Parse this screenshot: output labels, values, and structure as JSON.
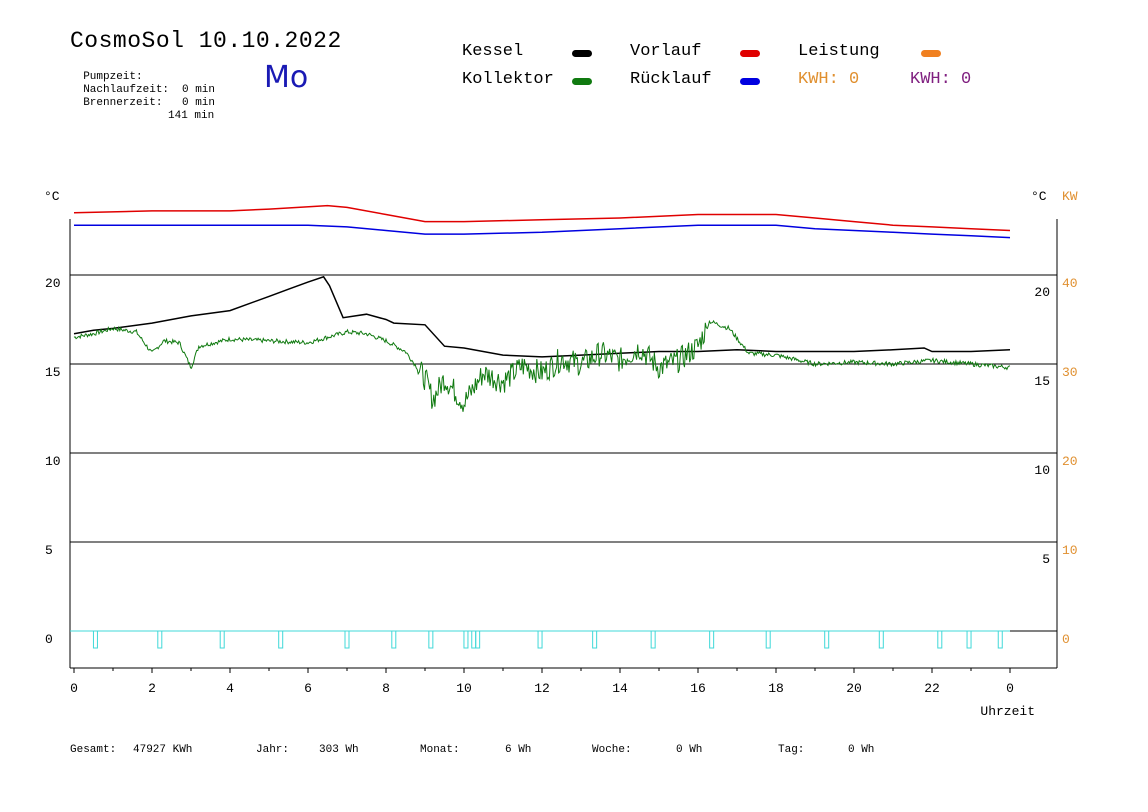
{
  "header": {
    "title": "CosmoSol 10.10.2022",
    "day": "Mo",
    "stats": [
      {
        "label": "Pumpzeit:",
        "value": "0 min"
      },
      {
        "label": "Nachlaufzeit:",
        "value": "0 min"
      },
      {
        "label": "Brennerzeit:",
        "value": "141 min"
      }
    ]
  },
  "legend": {
    "items": [
      {
        "label": "Kessel",
        "color": "#000000"
      },
      {
        "label": "Vorlauf",
        "color": "#e00000"
      },
      {
        "label": "Leistung",
        "color": "#f08020"
      },
      {
        "label": "Kollektor",
        "color": "#107a10"
      },
      {
        "label": "Rücklauf",
        "color": "#0000e0"
      }
    ],
    "kwh_orange": "KWH: 0",
    "kwh_purple": "KWH: 0",
    "kwh_orange_color": "#e09030",
    "kwh_purple_color": "#802080"
  },
  "footer": {
    "gesamt_label": "Gesamt:",
    "gesamt_value": "47927 KWh",
    "jahr_label": "Jahr:",
    "jahr_value": "303 Wh",
    "monat_label": "Monat:",
    "monat_value": "6 Wh",
    "woche_label": "Woche:",
    "woche_value": "0 Wh",
    "tag_label": "Tag:",
    "tag_value": "0 Wh"
  },
  "chart_data": {
    "type": "line",
    "xlabel": "Uhrzeit",
    "left_unit": "°C",
    "right_unit": "°C",
    "right_unit2": "KW",
    "left_ticks": [
      "20",
      "15",
      "10",
      "5",
      "0"
    ],
    "right_ticks": [
      "20",
      "15",
      "10",
      "5"
    ],
    "kw_ticks": [
      "40",
      "30",
      "20",
      "10",
      "0"
    ],
    "x_ticks": [
      "0",
      "2",
      "4",
      "6",
      "8",
      "10",
      "12",
      "14",
      "16",
      "18",
      "20",
      "22",
      "0"
    ],
    "xlim": [
      0,
      24
    ],
    "ylim": [
      0,
      20
    ],
    "grid": "horizontal",
    "colors": {
      "kessel": "#000000",
      "kollektor": "#107a10",
      "vorlauf": "#e00000",
      "ruecklauf": "#0000e0",
      "pump": "#40d8d8",
      "kw_axis": "#e09030"
    },
    "series": [
      {
        "name": "Kessel",
        "x": [
          0,
          0.5,
          1,
          2,
          3,
          4,
          5,
          5.5,
          6,
          6.4,
          6.55,
          6.9,
          7.5,
          8,
          8.2,
          9,
          9.5,
          10,
          11,
          12,
          13,
          14,
          15,
          16,
          17,
          18,
          19,
          20,
          21,
          21.8,
          22,
          23,
          24
        ],
        "y": [
          16.7,
          16.9,
          17.0,
          17.3,
          17.7,
          18.0,
          18.8,
          19.2,
          19.6,
          19.9,
          19.4,
          17.6,
          17.8,
          17.5,
          17.3,
          17.2,
          16.0,
          15.9,
          15.5,
          15.4,
          15.5,
          15.6,
          15.7,
          15.7,
          15.8,
          15.7,
          15.7,
          15.7,
          15.8,
          15.9,
          15.7,
          15.7,
          15.8
        ]
      },
      {
        "name": "Kollektor",
        "x": [
          0,
          0.5,
          1,
          1.6,
          2,
          2.3,
          2.7,
          3,
          3.2,
          4,
          5,
          6,
          7,
          7.5,
          8,
          8.5,
          9,
          9.2,
          9.5,
          10,
          10.5,
          11,
          11.5,
          12,
          12.5,
          13,
          13.5,
          14,
          14.5,
          15,
          15.5,
          16,
          16.3,
          16.8,
          17.3,
          18,
          19,
          20,
          21,
          22,
          23,
          24
        ],
        "y": [
          16.5,
          16.7,
          17.0,
          16.8,
          15.6,
          16.3,
          16.2,
          14.8,
          16.0,
          16.4,
          16.3,
          16.2,
          16.8,
          16.7,
          16.3,
          15.7,
          14.2,
          13.0,
          14.2,
          12.8,
          14.5,
          14.0,
          14.9,
          14.5,
          15.3,
          15.0,
          15.6,
          15.2,
          15.9,
          14.8,
          15.2,
          16.0,
          17.4,
          17.0,
          15.6,
          15.5,
          15.0,
          15.1,
          15.0,
          15.2,
          15.0,
          14.8
        ]
      },
      {
        "name": "Vorlauf",
        "x": [
          0,
          2,
          4,
          5,
          6.5,
          7,
          8,
          9,
          10,
          12,
          14,
          16,
          18,
          19,
          20,
          21,
          22,
          23,
          24
        ],
        "y": [
          23.5,
          23.6,
          23.6,
          23.7,
          23.9,
          23.8,
          23.4,
          23.0,
          23.0,
          23.1,
          23.2,
          23.4,
          23.4,
          23.2,
          23.0,
          22.8,
          22.7,
          22.6,
          22.5
        ]
      },
      {
        "name": "Rücklauf",
        "x": [
          0,
          2,
          4,
          6,
          7,
          8,
          9,
          10,
          12,
          14,
          16,
          18,
          19,
          20,
          21,
          22,
          23,
          24
        ],
        "y": [
          22.8,
          22.8,
          22.8,
          22.8,
          22.7,
          22.5,
          22.3,
          22.3,
          22.4,
          22.6,
          22.8,
          22.8,
          22.6,
          22.5,
          22.4,
          22.3,
          22.2,
          22.1
        ]
      }
    ],
    "pump_pulses_h": [
      0.55,
      2.2,
      3.8,
      5.3,
      7.0,
      8.2,
      9.15,
      10.05,
      10.25,
      10.35,
      11.95,
      13.35,
      14.85,
      16.35,
      17.8,
      19.3,
      20.7,
      22.2,
      22.95,
      23.75
    ]
  }
}
